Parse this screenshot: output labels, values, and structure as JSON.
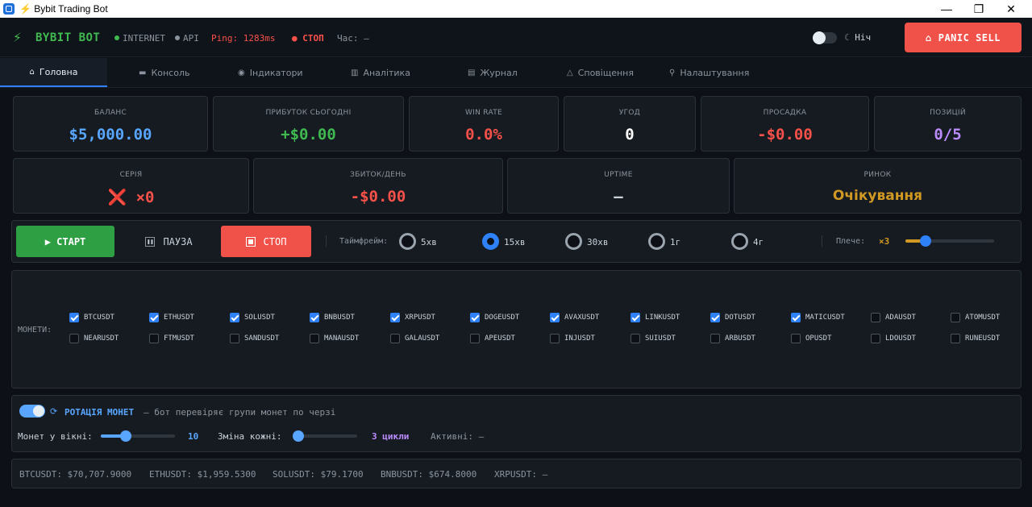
{
  "window": {
    "title": "⚡ Bybit Trading Bot",
    "minimize": "—",
    "maximize": "❐",
    "close": "✕"
  },
  "header": {
    "logo_icon": "⚡",
    "logo": "BYBIT BOT",
    "internet": "INTERNET",
    "api": "API",
    "ping": "Ping: 1283ms",
    "stop_status": "● СТОП",
    "time": "Час: —",
    "night_label": "Ніч",
    "panic": "PANIC SELL",
    "colors": {
      "green": "#3fb950",
      "red": "#f85149",
      "blue": "#2f81f7"
    }
  },
  "tabs": [
    {
      "icon": "⌂",
      "label": "Головна"
    },
    {
      "icon": "▬",
      "label": "Консоль"
    },
    {
      "icon": "◉",
      "label": "Індикатори"
    },
    {
      "icon": "▥",
      "label": "Аналітика"
    },
    {
      "icon": "▤",
      "label": "Журнал"
    },
    {
      "icon": "△",
      "label": "Сповіщення"
    },
    {
      "icon": "⚲",
      "label": "Налаштування"
    }
  ],
  "stats": {
    "balance": {
      "label": "БАЛАНС",
      "value": "$5,000.00"
    },
    "profit_today": {
      "label": "ПРИБУТОК СЬОГОДНІ",
      "value": "+$0.00"
    },
    "win_rate": {
      "label": "WIN RATE",
      "value": "0.0%"
    },
    "trades": {
      "label": "УГОД",
      "value": "0"
    },
    "drawdown": {
      "label": "ПРОСАДКА",
      "value": "-$0.00"
    },
    "positions": {
      "label": "ПОЗИЦІЙ",
      "value": "0/5"
    },
    "streak": {
      "label": "СЕРІЯ",
      "value": "❌ ×0"
    },
    "loss_day": {
      "label": "ЗБИТОК/ДЕНЬ",
      "value": "-$0.00"
    },
    "uptime": {
      "label": "UPTIME",
      "value": "—"
    },
    "market": {
      "label": "РИНОК",
      "value": "Очікування"
    }
  },
  "controls": {
    "start": "▶  СТАРТ",
    "pause": "ПАУЗА",
    "stop": "СТОП",
    "timeframe_label": "Таймфрейм:",
    "timeframes": [
      "5хв",
      "15хв",
      "30хв",
      "1г",
      "4г"
    ],
    "timeframe_selected": "15хв",
    "leverage_label": "Плече:",
    "leverage_value": "×3",
    "leverage_level": 0.23
  },
  "coins": {
    "label": "МОНЕТИ:",
    "row1": [
      {
        "name": "BTCUSDT",
        "checked": true
      },
      {
        "name": "ETHUSDT",
        "checked": true
      },
      {
        "name": "SOLUSDT",
        "checked": true
      },
      {
        "name": "BNBUSDT",
        "checked": true
      },
      {
        "name": "XRPUSDT",
        "checked": true
      },
      {
        "name": "DOGEUSDT",
        "checked": true
      },
      {
        "name": "AVAXUSDT",
        "checked": true
      },
      {
        "name": "LINKUSDT",
        "checked": true
      },
      {
        "name": "DOTUSDT",
        "checked": true
      },
      {
        "name": "MATICUSDT",
        "checked": true
      },
      {
        "name": "ADAUSDT",
        "checked": false
      },
      {
        "name": "ATOMUSDT",
        "checked": false
      }
    ],
    "row2": [
      {
        "name": "NEARUSDT",
        "checked": false
      },
      {
        "name": "FTMUSDT",
        "checked": false
      },
      {
        "name": "SANDUSDT",
        "checked": false
      },
      {
        "name": "MANAUSDT",
        "checked": false
      },
      {
        "name": "GALAUSDT",
        "checked": false
      },
      {
        "name": "APEUSDT",
        "checked": false
      },
      {
        "name": "INJUSDT",
        "checked": false
      },
      {
        "name": "SUIUSDT",
        "checked": false
      },
      {
        "name": "ARBUSDT",
        "checked": false
      },
      {
        "name": "OPUSDT",
        "checked": false
      },
      {
        "name": "LDOUSDT",
        "checked": false
      },
      {
        "name": "RUNEUSDT",
        "checked": false
      }
    ]
  },
  "rotation": {
    "title": "РОТАЦІЯ МОНЕТ",
    "desc": "— бот перевіряє групи монет по черзі",
    "window_label": "Монет у вікні:",
    "window_value": "10",
    "change_label": "Зміна кожні:",
    "change_value": "3 цикли",
    "active": "Активні: —"
  },
  "tickers": [
    "BTCUSDT: $70,707.9000",
    "ETHUSDT: $1,959.5300",
    "SOLUSDT: $79.1700",
    "BNBUSDT: $674.8000",
    "XRPUSDT: —"
  ]
}
